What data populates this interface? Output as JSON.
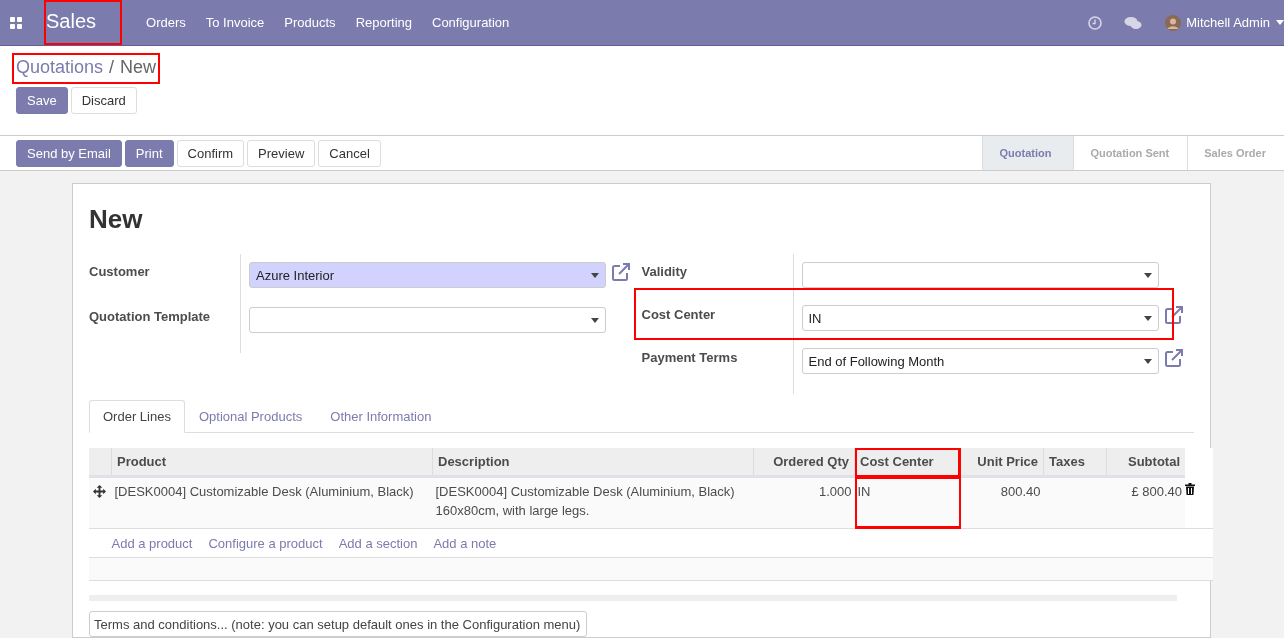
{
  "navbar": {
    "app_name": "Sales",
    "app_highlighted": true,
    "menu": [
      "Orders",
      "To Invoice",
      "Products",
      "Reporting",
      "Configuration"
    ],
    "user": "Mitchell Admin"
  },
  "breadcrumb": {
    "parent": "Quotations",
    "separator": "/",
    "current": "New",
    "highlighted": true
  },
  "form_buttons": [
    {
      "label": "Save",
      "primary": true
    },
    {
      "label": "Discard",
      "primary": false
    }
  ],
  "action_buttons": [
    {
      "label": "Send by Email",
      "primary": true
    },
    {
      "label": "Print",
      "primary": true
    },
    {
      "label": "Confirm",
      "primary": false
    },
    {
      "label": "Preview",
      "primary": false
    },
    {
      "label": "Cancel",
      "primary": false
    }
  ],
  "status_steps": [
    {
      "label": "Quotation",
      "selected": true
    },
    {
      "label": "Quotation Sent",
      "selected": false
    },
    {
      "label": "Sales Order",
      "selected": false
    }
  ],
  "record_title": "New",
  "left_fields": [
    {
      "label": "Customer",
      "value": "Azure Interior",
      "required": true,
      "external_link": true,
      "highlighted": false
    },
    {
      "label": "Quotation Template",
      "required": false,
      "external_link": false,
      "highlighted": false
    }
  ],
  "right_fields": [
    {
      "label": "Validity",
      "required": false,
      "external_link": false,
      "highlighted": false
    },
    {
      "label": "Cost Center",
      "value": "IN",
      "required": false,
      "external_link": true,
      "highlighted": true
    },
    {
      "label": "Payment Terms",
      "value": "End of Following Month",
      "required": false,
      "external_link": true,
      "highlighted": false
    }
  ],
  "tabs": [
    {
      "label": "Order Lines",
      "selected": true
    },
    {
      "label": "Optional Products",
      "selected": false
    },
    {
      "label": "Other Information",
      "selected": false
    }
  ],
  "table": {
    "columns": [
      {
        "label": "Product",
        "highlighted": false
      },
      {
        "label": "Description",
        "highlighted": false
      },
      {
        "label": "Ordered Qty",
        "highlighted": false
      },
      {
        "label": "Cost Center",
        "highlighted": true
      },
      {
        "label": "Unit Price",
        "highlighted": false
      },
      {
        "label": "Taxes",
        "highlighted": false
      },
      {
        "label": "Subtotal",
        "highlighted": false
      }
    ],
    "rows": [
      {
        "cells": [
          "[DESK0004] Customizable Desk (Aluminium, Black)",
          "[DESK0004] Customizable Desk (Aluminium, Black) 160x80cm, with large legs.",
          "1.000",
          "IN",
          "800.40",
          "",
          "£ 800.40"
        ]
      }
    ],
    "add_links": [
      "Add a product",
      "Configure a product",
      "Add a section",
      "Add a note"
    ]
  },
  "terms": {
    "placeholder": "Terms and conditions... (note: you can setup default ones in the Configuration menu)"
  }
}
